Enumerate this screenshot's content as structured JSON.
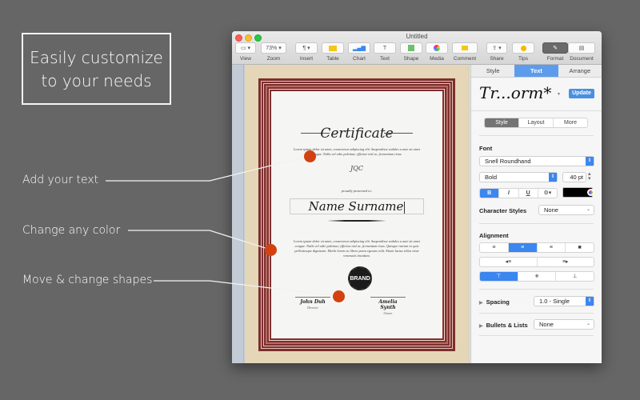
{
  "promo": {
    "headline_line1": "Easily customize",
    "headline_line2": "to your needs",
    "callouts": [
      "Add your text",
      "Change any color",
      "Move & change shapes"
    ],
    "accent_color": "#d2410f"
  },
  "window": {
    "title": "Untitled",
    "toolbar": {
      "view": {
        "label": "View",
        "icon": "sidebar-icon"
      },
      "zoom": {
        "label": "Zoom",
        "value": "73%"
      },
      "insert": {
        "label": "Insert",
        "icon": "paragraph-icon"
      },
      "table": {
        "label": "Table",
        "icon": "table-icon"
      },
      "chart": {
        "label": "Chart",
        "icon": "chart-icon"
      },
      "text": {
        "label": "Text",
        "icon": "text-icon"
      },
      "shape": {
        "label": "Shape",
        "icon": "shape-icon"
      },
      "media": {
        "label": "Media",
        "icon": "media-icon"
      },
      "comment": {
        "label": "Comment",
        "icon": "comment-icon"
      },
      "share": {
        "label": "Share",
        "icon": "share-icon"
      },
      "tips": {
        "label": "Tips",
        "icon": "tips-icon"
      },
      "format": {
        "label": "Format",
        "icon": "paintbrush-icon",
        "active": true
      },
      "document": {
        "label": "Document",
        "icon": "document-icon"
      }
    }
  },
  "certificate": {
    "title": "Certificate",
    "intro_text": "Lorem ipsum dolor sit amet, consectetur adipiscing elit. Suspendisse sodales a ante sit amet congue. Nulla vel odio pulvinar, efficitur nisl ac, fermentum risus.",
    "monogram": "JQC",
    "presented_to": "proudly presented to:",
    "recipient_name": "Name Surname",
    "body_text": "Lorem ipsum dolor sit amet, consectetur adipiscing elit. Suspendisse sodales a ante sit amet congue. Nulla vel odio pulvinar, efficitur nisl ac, fermentum risus. Quisque rutrum ex quis pellentesque dignissim. Morbi lorem eu libero porta egestas velit. Etiam luctus tellus vitae venenatis tincidunt.",
    "badge_text": "BRAND",
    "signatures": [
      {
        "name": "John Duh",
        "role": "Director"
      },
      {
        "name": "Amelia Synth",
        "role": "Owner"
      }
    ]
  },
  "inspector": {
    "tabs": [
      {
        "label": "Style",
        "active": false
      },
      {
        "label": "Text",
        "active": true
      },
      {
        "label": "Arrange",
        "active": false
      }
    ],
    "paragraph_style_preview": "Tr...orm*",
    "update_label": "Update",
    "subtabs": [
      {
        "label": "Style",
        "active": true
      },
      {
        "label": "Layout",
        "active": false
      },
      {
        "label": "More",
        "active": false
      }
    ],
    "font": {
      "section_label": "Font",
      "family": "Snell Roundhand",
      "typeface": "Bold",
      "size": "40 pt",
      "bold_label": "B",
      "italic_label": "I",
      "underline_label": "U",
      "text_color": "#000000"
    },
    "character_styles": {
      "label": "Character Styles",
      "value": "None"
    },
    "alignment": {
      "section_label": "Alignment",
      "horizontal_selected": "center",
      "vertical_selected": "top"
    },
    "spacing": {
      "label": "Spacing",
      "value": "1.0 - Single"
    },
    "bullets": {
      "label": "Bullets & Lists",
      "value": "None"
    }
  }
}
